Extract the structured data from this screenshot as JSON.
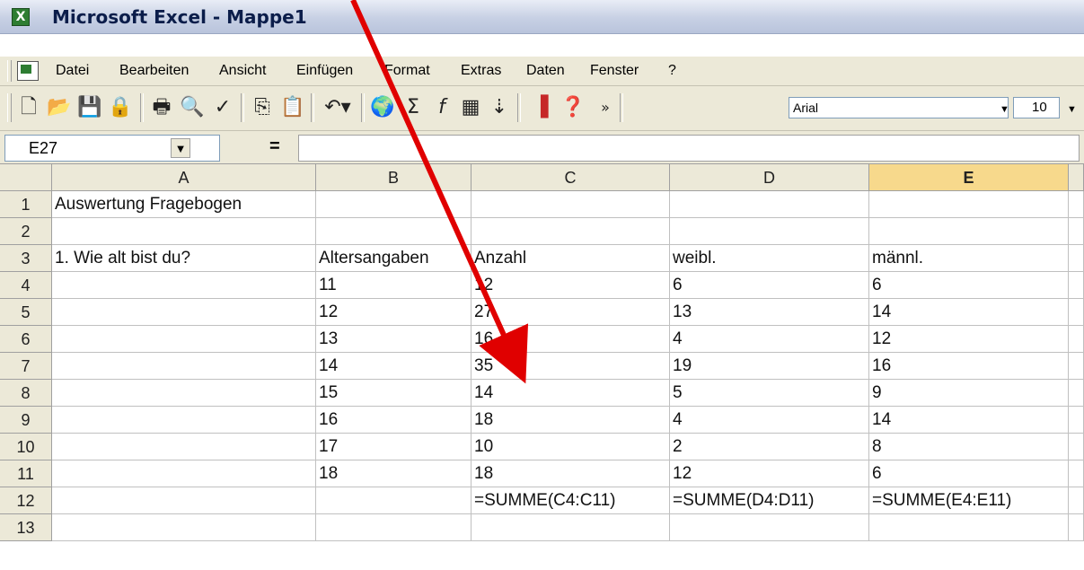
{
  "window": {
    "title": "Microsoft Excel - Mappe1"
  },
  "menu": [
    "Datei",
    "Bearbeiten",
    "Ansicht",
    "Einfügen",
    "Format",
    "Extras",
    "Daten",
    "Fenster",
    "?"
  ],
  "toolbar": {
    "font_name": "Arial",
    "font_size": "10",
    "icons": [
      "new-icon",
      "open-icon",
      "save-icon",
      "permission-icon",
      "print-icon",
      "print-preview-icon",
      "spelling-icon",
      "copy-icon",
      "paste-icon",
      "undo-icon",
      "web-icon",
      "autosum-icon",
      "function-icon",
      "drawing-icon",
      "sort-ascending-icon",
      "chart-wizard-icon",
      "help-icon",
      "more-buttons-icon"
    ]
  },
  "formula_bar": {
    "name_box": "E27",
    "equals": "=",
    "formula": ""
  },
  "sheet": {
    "columns": [
      "A",
      "B",
      "C",
      "D",
      "E"
    ],
    "active_column": "E",
    "rows": [
      {
        "n": "1",
        "cells": [
          "Auswertung Fragebogen",
          "",
          "",
          "",
          ""
        ]
      },
      {
        "n": "2",
        "cells": [
          "",
          "",
          "",
          "",
          ""
        ]
      },
      {
        "n": "3",
        "cells": [
          "1. Wie alt bist du?",
          "Altersangaben",
          "Anzahl",
          "weibl.",
          "männl."
        ]
      },
      {
        "n": "4",
        "cells": [
          "",
          "11",
          "12",
          "6",
          "6"
        ]
      },
      {
        "n": "5",
        "cells": [
          "",
          "12",
          "27",
          "13",
          "14"
        ]
      },
      {
        "n": "6",
        "cells": [
          "",
          "13",
          "16",
          "4",
          "12"
        ]
      },
      {
        "n": "7",
        "cells": [
          "",
          "14",
          "35",
          "19",
          "16"
        ]
      },
      {
        "n": "8",
        "cells": [
          "",
          "15",
          "14",
          "5",
          "9"
        ]
      },
      {
        "n": "9",
        "cells": [
          "",
          "16",
          "18",
          "4",
          "14"
        ]
      },
      {
        "n": "10",
        "cells": [
          "",
          "17",
          "10",
          "2",
          "8"
        ]
      },
      {
        "n": "11",
        "cells": [
          "",
          "18",
          "18",
          "12",
          "6"
        ]
      },
      {
        "n": "12",
        "cells": [
          "",
          "",
          "=SUMME(C4:C11)",
          "=SUMME(D4:D11)",
          "=SUMME(E4:E11)"
        ]
      },
      {
        "n": "13",
        "cells": [
          "",
          "",
          "",
          "",
          ""
        ]
      }
    ]
  },
  "annotation": {
    "arrow_color": "#e00000"
  }
}
